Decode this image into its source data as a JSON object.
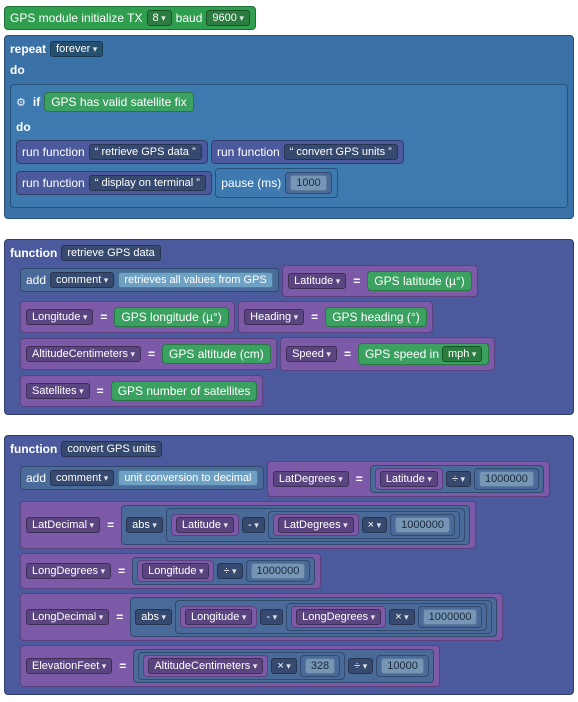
{
  "init": {
    "label": "GPS module initialize TX",
    "tx": "8",
    "baudLabel": "baud",
    "baud": "9600"
  },
  "repeat": {
    "label": "repeat",
    "mode": "forever",
    "doLabel": "do",
    "if": {
      "ifLabel": "if",
      "condition": "GPS has valid satellite fix",
      "doLabel": "do",
      "runFuncLabel": "run function",
      "calls": [
        "retrieve GPS data",
        "convert GPS units",
        "display on terminal"
      ],
      "pauseLabel": "pause (ms)",
      "pauseMs": "1000"
    }
  },
  "func1": {
    "funcLabel": "function",
    "name": "retrieve GPS data",
    "addLabel": "add",
    "commentLabel": "comment",
    "commentText": "retrieves all values from GPS",
    "rows": [
      {
        "var": "Latitude",
        "expr": "GPS latitude (µ°)"
      },
      {
        "var": "Longitude",
        "expr": "GPS longitude (µ°)"
      },
      {
        "var": "Heading",
        "expr": "GPS heading (°)"
      },
      {
        "var": "AltitudeCentimeters",
        "expr": "GPS altitude (cm)"
      },
      {
        "var": "Satellites",
        "expr": "GPS number of satellites"
      }
    ],
    "speed": {
      "var": "Speed",
      "prefix": "GPS speed in",
      "unit": "mph"
    },
    "eq": "="
  },
  "func2": {
    "funcLabel": "function",
    "name": "convert GPS units",
    "addLabel": "add",
    "commentLabel": "comment",
    "commentText": "unit conversion to decimal",
    "eq": "=",
    "abs": "abs",
    "div": "÷",
    "mul": "×",
    "sub": "-",
    "million": "1000000",
    "r1": {
      "var": "LatDegrees",
      "a": "Latitude"
    },
    "r2": {
      "var": "LatDecimal",
      "a": "Latitude",
      "b": "LatDegrees"
    },
    "r3": {
      "var": "LongDegrees",
      "a": "Longitude"
    },
    "r4": {
      "var": "LongDecimal",
      "a": "Longitude",
      "b": "LongDegrees"
    },
    "r5": {
      "var": "ElevationFeet",
      "a": "AltitudeCentimeters",
      "n1": "328",
      "n2": "10000"
    }
  }
}
